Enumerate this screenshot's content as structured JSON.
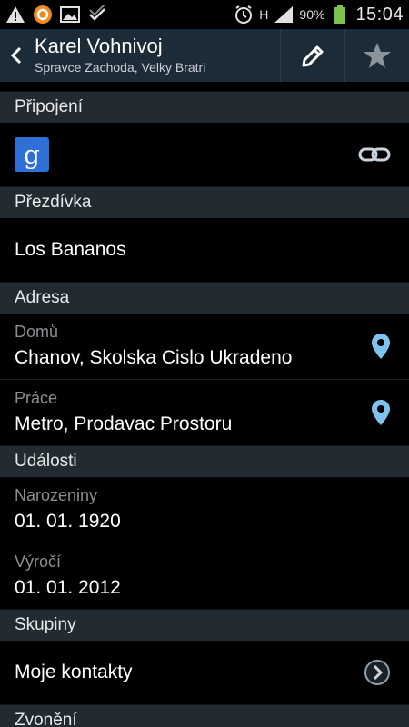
{
  "status_bar": {
    "battery": "90%",
    "network": "H",
    "time": "15:04"
  },
  "action_bar": {
    "title": "Karel Vohnivoj",
    "subtitle": "Spravce Zachoda, Velky Bratri"
  },
  "sections": {
    "connection": {
      "header": "Připojení",
      "service_icon_letter": "g"
    },
    "nickname": {
      "header": "Přezdívka",
      "value": "Los Bananos"
    },
    "address": {
      "header": "Adresa",
      "home": {
        "label": "Domů",
        "value": "Chanov, Skolska Cislo Ukradeno"
      },
      "work": {
        "label": "Práce",
        "value": "Metro, Prodavac Prostoru"
      }
    },
    "events": {
      "header": "Události",
      "birthday": {
        "label": "Narozeniny",
        "value": "01. 01. 1920"
      },
      "anniversary": {
        "label": "Výročí",
        "value": "01. 01. 2012"
      }
    },
    "groups": {
      "header": "Skupiny",
      "value": "Moje kontakty"
    },
    "ringtone": {
      "header": "Zvonění"
    }
  },
  "colors": {
    "actionbar": "#1c2b38",
    "section_header": "#222b31",
    "accent": "#7ec3f0",
    "google_blue": "#2f6fd8"
  },
  "icons": {
    "status": [
      "warning-icon",
      "notification-app-icon",
      "gallery-icon",
      "sync-icon",
      "alarm-icon",
      "signal-icon",
      "battery-icon"
    ],
    "action": [
      "back-icon",
      "edit-icon",
      "star-icon"
    ],
    "rows": [
      "google-icon",
      "link-icon",
      "location-pin-icon",
      "chevron-right-icon"
    ]
  }
}
